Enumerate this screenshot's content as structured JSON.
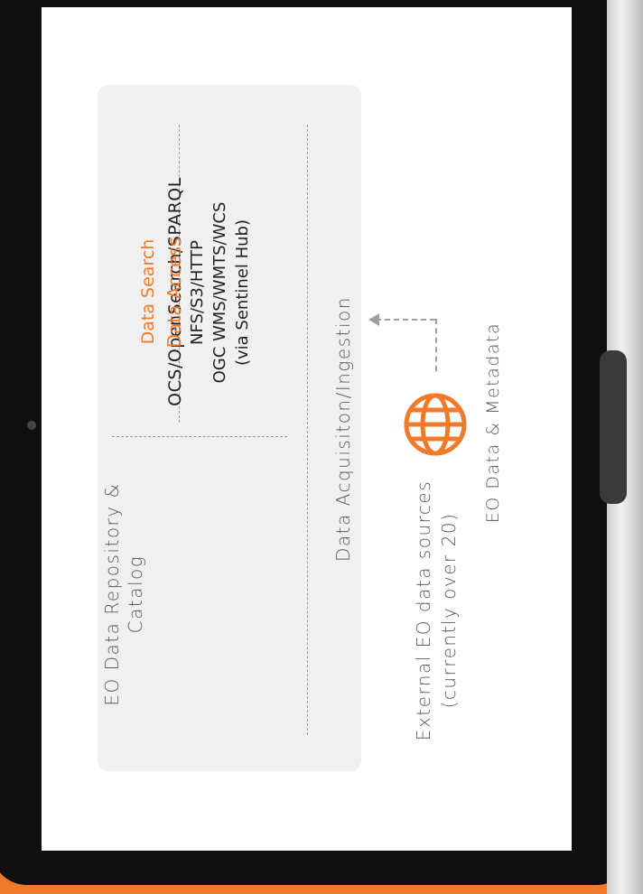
{
  "repository": {
    "title": "EO Data Repository & Catalog",
    "title_line1": "EO Data Repository &",
    "title_line2": "Catalog"
  },
  "search": {
    "heading": "Data Search",
    "protocols": "OCS/OpenSearch/SPARQL"
  },
  "access": {
    "heading": "Data Access",
    "line1": "NFS/S3/HTTP",
    "line2": "OGC WMS/WMTS/WCS",
    "line3": "(via Sentinel Hub)"
  },
  "ingestion": {
    "label": "Data Acquisiton/Ingestion"
  },
  "external": {
    "line1": "External EO data sources",
    "line2": "(currently over 20)",
    "icon": "globe-icon"
  },
  "flow_label": "EO Data & Metadata",
  "colors": {
    "accent": "#f07a2a",
    "panel": "#f0f0f0",
    "text": "#222222"
  }
}
